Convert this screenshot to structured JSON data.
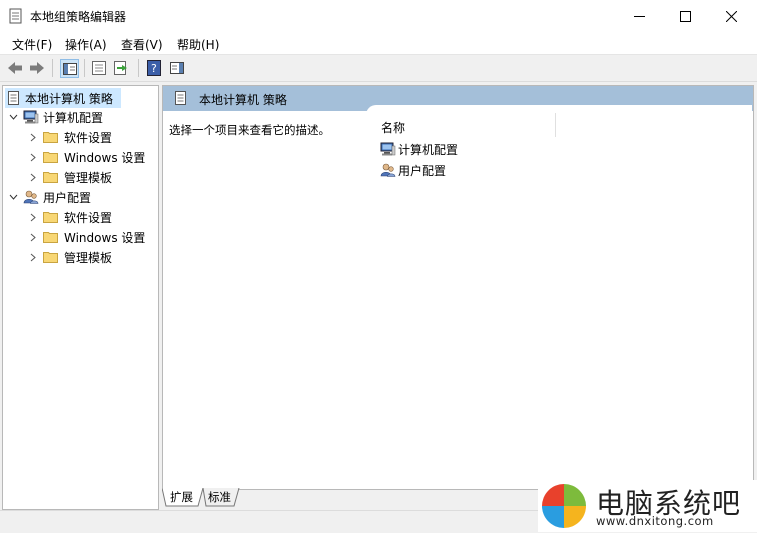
{
  "window": {
    "title": "本地组策略编辑器"
  },
  "menu": [
    "文件(F)",
    "操作(A)",
    "查看(V)",
    "帮助(H)"
  ],
  "toolbar": {
    "icons": [
      "back-arrow-icon",
      "forward-arrow-icon",
      "show-hide-tree-icon",
      "properties-icon",
      "export-list-icon",
      "help-icon",
      "show-action-pane-icon"
    ]
  },
  "tree": {
    "root": "本地计算机 策略",
    "computer": {
      "label": "计算机配置",
      "children": [
        "软件设置",
        "Windows 设置",
        "管理模板"
      ]
    },
    "user": {
      "label": "用户配置",
      "children": [
        "软件设置",
        "Windows 设置",
        "管理模板"
      ]
    }
  },
  "right": {
    "header": "本地计算机 策略",
    "description": "选择一个项目来查看它的描述。",
    "column_name": "名称",
    "items": [
      "计算机配置",
      "用户配置"
    ]
  },
  "tabs": [
    "扩展",
    "标准"
  ],
  "watermark": {
    "title": "电脑系统吧",
    "url": "www.dnxitong.com"
  },
  "colors": {
    "header_band": "#a4bfd9",
    "selected_bg": "#cde8ff",
    "folder": "#f8d775"
  }
}
